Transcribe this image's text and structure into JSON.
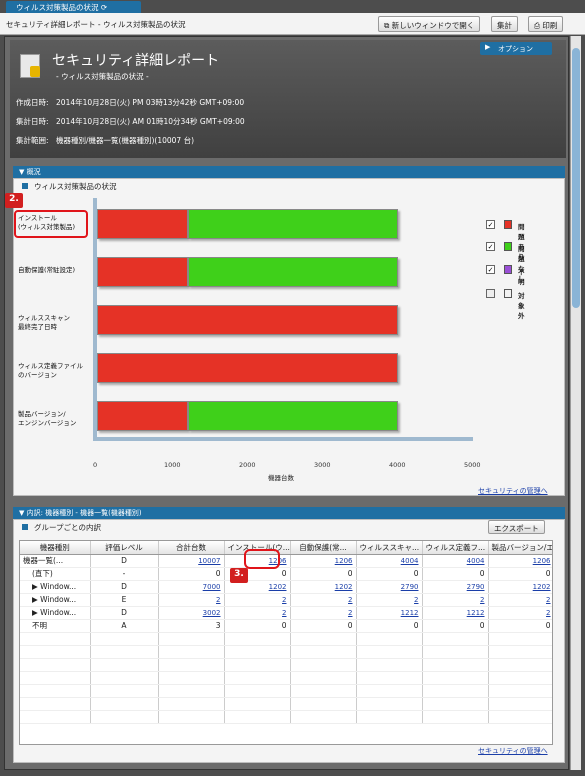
{
  "tab": {
    "label": "ウィルス対策製品の状況"
  },
  "breadcrumb": "セキュリティ詳細レポート - ウィルス対策製品の状況",
  "toolbar": {
    "new_window": "新しいウィンドウで開く",
    "aggregate": "集計",
    "print": "印刷"
  },
  "header": {
    "title": "セキュリティ詳細レポート",
    "subtitle": "- ウィルス対策製品の状況 -",
    "option": "オプション",
    "created": "作成日時:　2014年10月28日(火) PM 03時13分42秒 GMT+09:00",
    "aggregated": "集計日時:　2014年10月28日(火) AM 01時10分34秒 GMT+09:00",
    "range": "集計範囲:　機器種別/機器一覧(機器種別)(10007 台)"
  },
  "overview": {
    "section": "概況",
    "subtitle": "ウィルス対策製品の状況",
    "categories_line1": [
      "インストール",
      "自動保護(常駐設定)",
      "ウィルススキャン",
      "ウィルス定義ファイル",
      "製品バージョン/"
    ],
    "categories_line2": [
      "(ウィルス対策製品)",
      "",
      "最終完了日時",
      "のバージョン",
      "エンジンバージョン"
    ],
    "legend": [
      {
        "label": "問題あり",
        "color": "#e53226",
        "checked": true
      },
      {
        "label": "問題なし",
        "color": "#3fd01a",
        "checked": true
      },
      {
        "label": "不明",
        "color": "#9a4fd6",
        "checked": true
      },
      {
        "label": "対象外",
        "color": "#f2f2f2",
        "checked": false
      }
    ],
    "xlabel": "機器台数",
    "link": "セキュリティの管理へ"
  },
  "chart_data": {
    "type": "bar",
    "orientation": "horizontal",
    "stacked": true,
    "categories": [
      "インストール(ウィルス対策製品)",
      "自動保護(常駐設定)",
      "ウィルススキャン最終完了日時",
      "ウィルス定義ファイルのバージョン",
      "製品バージョン/エンジンバージョン"
    ],
    "series": [
      {
        "name": "問題あり",
        "values": [
          1206,
          1206,
          4004,
          4004,
          1206
        ]
      },
      {
        "name": "問題なし",
        "values": [
          2794,
          2794,
          0,
          0,
          2794
        ]
      }
    ],
    "xticks": [
      "0",
      "1000",
      "2000",
      "3000",
      "4000",
      "5000"
    ],
    "xlim": [
      0,
      5000
    ],
    "xlabel": "機器台数",
    "legend_position": "right"
  },
  "breakdown": {
    "section": "内訳: 機器種別 - 機器一覧(機器種別)",
    "subtitle": "グループごとの内訳",
    "export": "エクスポート",
    "columns": [
      "機器種別",
      "評価レベル",
      "合計台数",
      "インストール(ウ...",
      "自動保護(常...",
      "ウィルススキャ...",
      "ウィルス定義フ...",
      "製品バージョン/エ..."
    ],
    "rows": [
      {
        "name": "機器一覧(...",
        "level": "D",
        "total": "10007",
        "c1": "1206",
        "c2": "1206",
        "c3": "4004",
        "c4": "4004",
        "c5": "1206",
        "indent": false,
        "links": true
      },
      {
        "name": "(直下)",
        "level": "-",
        "total": "0",
        "c1": "0",
        "c2": "0",
        "c3": "0",
        "c4": "0",
        "c5": "0",
        "indent": true,
        "links": false
      },
      {
        "name": "▶ Window...",
        "level": "D",
        "total": "7000",
        "c1": "1202",
        "c2": "1202",
        "c3": "2790",
        "c4": "2790",
        "c5": "1202",
        "indent": true,
        "links": true
      },
      {
        "name": "▶ Window...",
        "level": "E",
        "total": "2",
        "c1": "2",
        "c2": "2",
        "c3": "2",
        "c4": "2",
        "c5": "2",
        "indent": true,
        "links": true
      },
      {
        "name": "▶ Window...",
        "level": "D",
        "total": "3002",
        "c1": "2",
        "c2": "2",
        "c3": "1212",
        "c4": "1212",
        "c5": "2",
        "indent": true,
        "links": true
      },
      {
        "name": "不明",
        "level": "A",
        "total": "3",
        "c1": "0",
        "c2": "0",
        "c3": "0",
        "c4": "0",
        "c5": "0",
        "indent": true,
        "links": false
      }
    ],
    "link": "セキュリティの管理へ"
  },
  "callouts": {
    "one": "2.",
    "two": "3."
  }
}
